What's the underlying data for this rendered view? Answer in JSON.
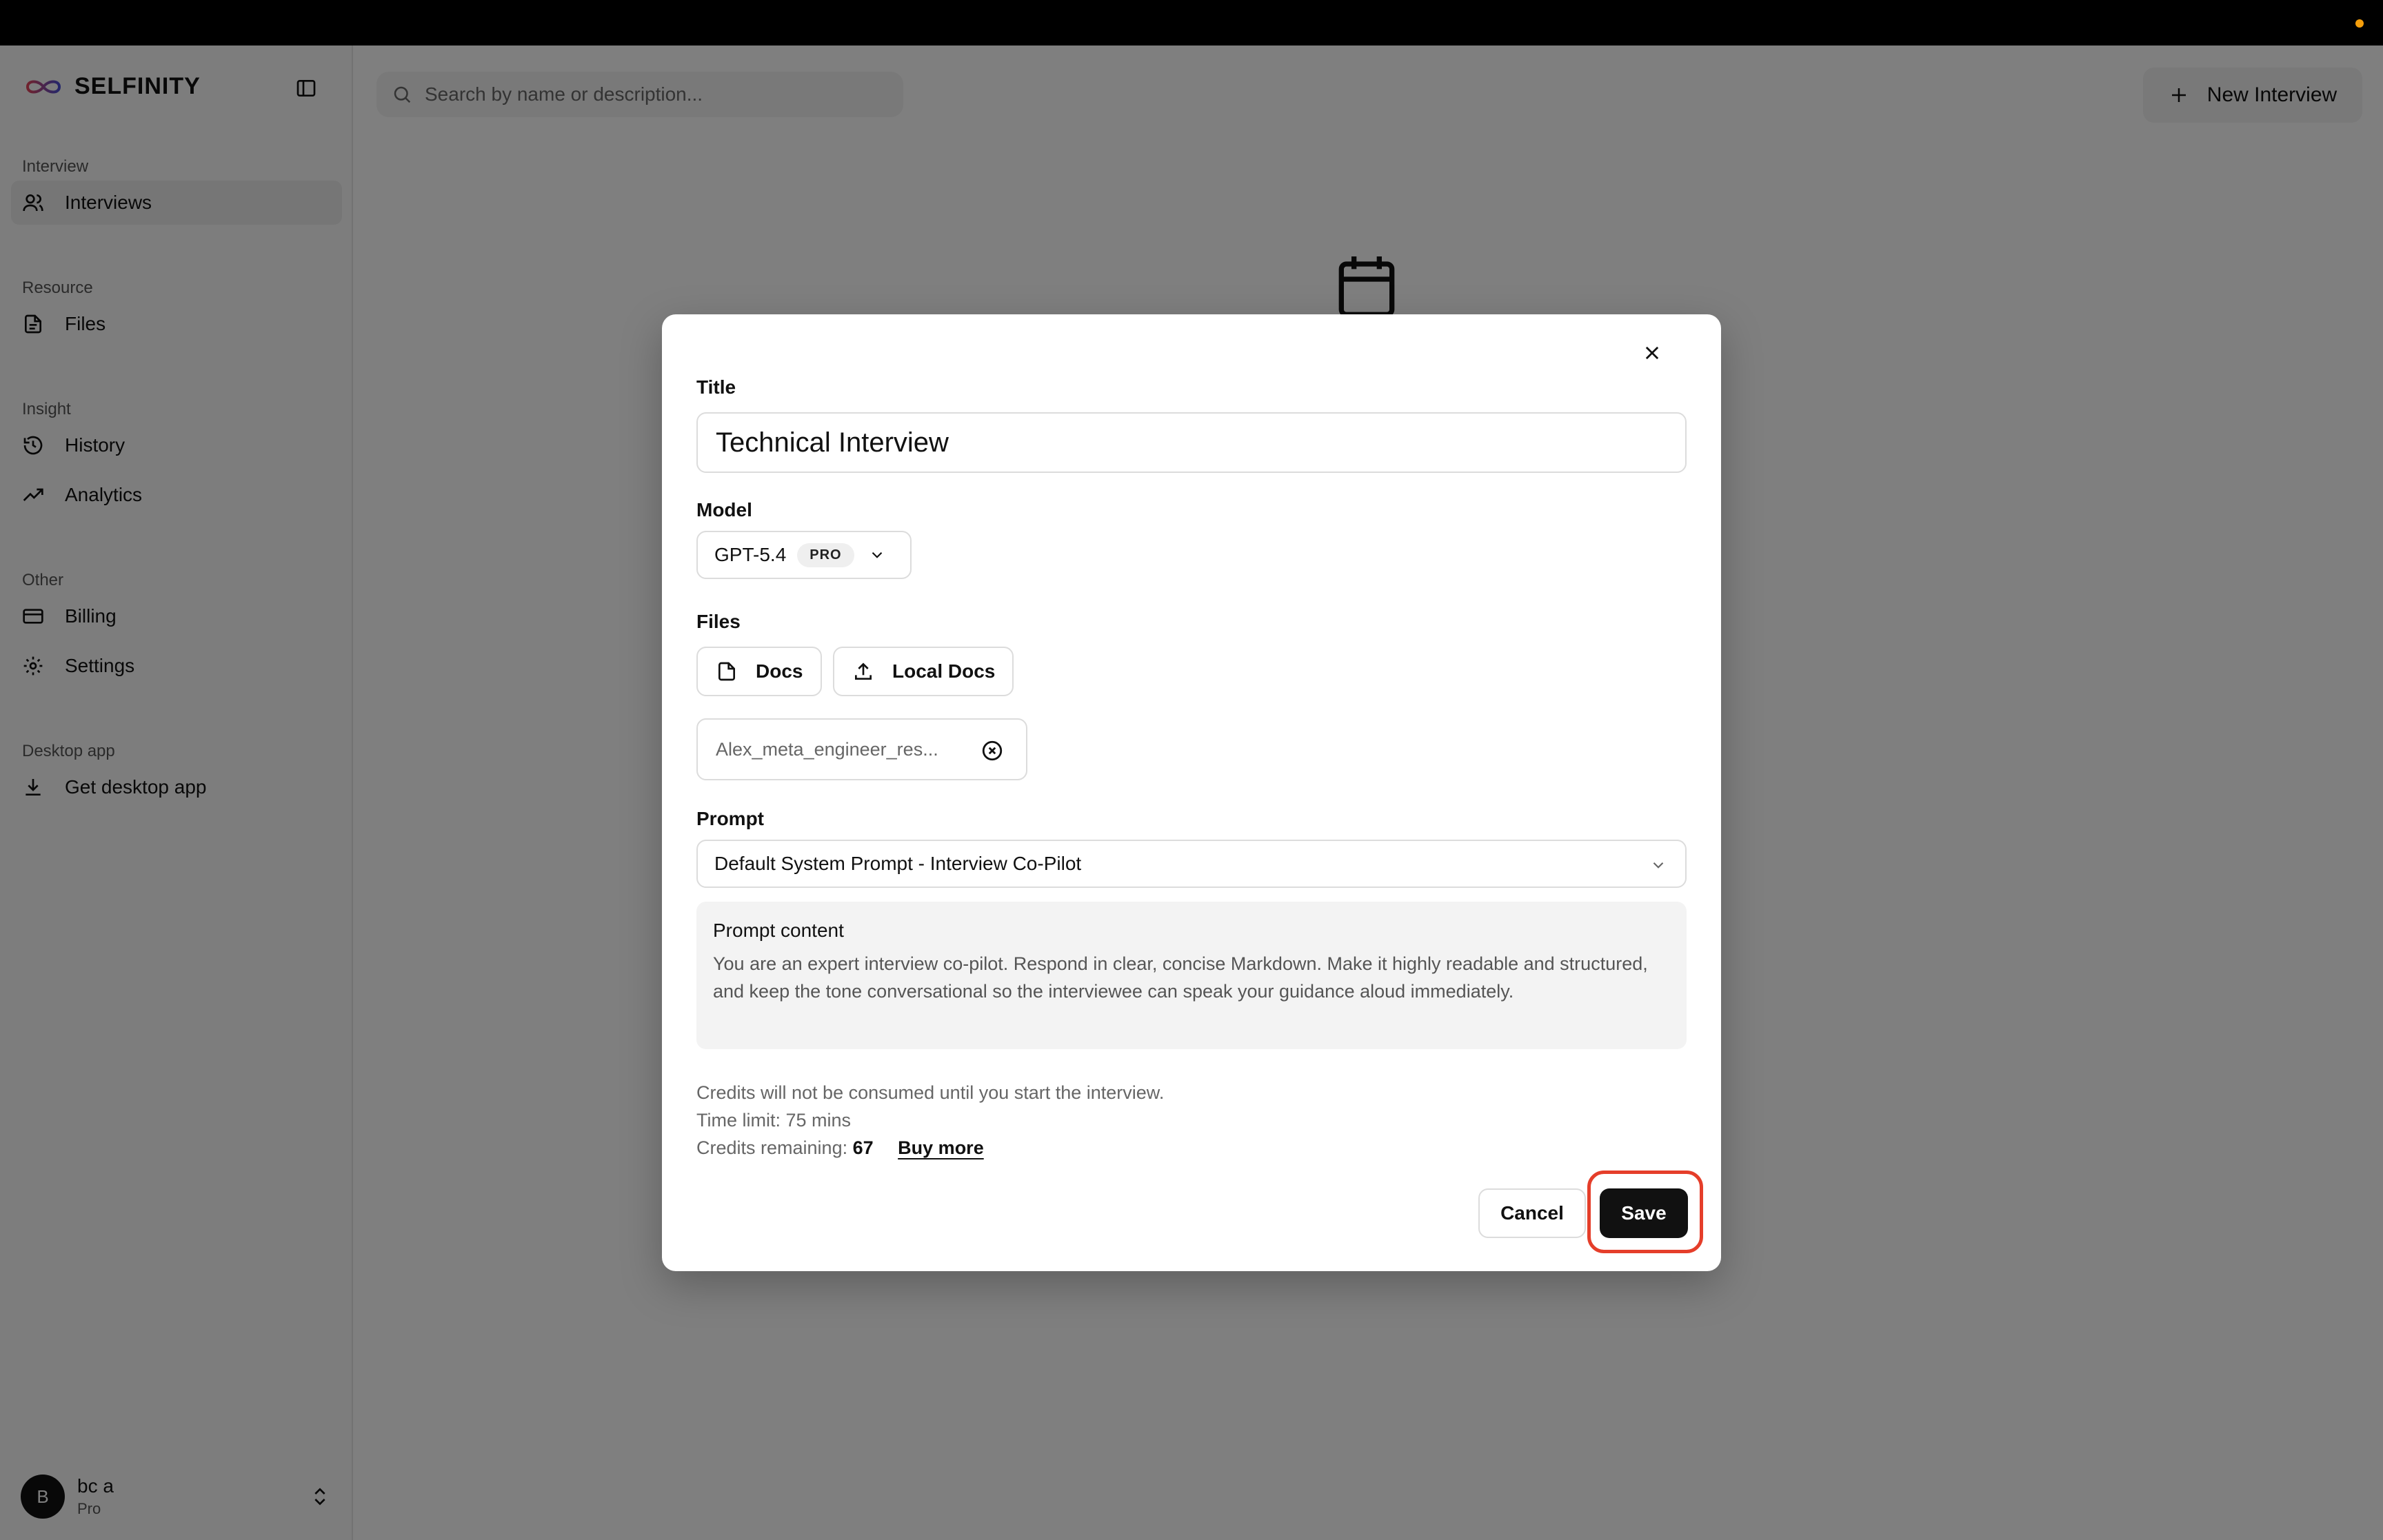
{
  "brand": {
    "name": "SELFINITY"
  },
  "sidebar": {
    "sections": [
      {
        "heading": "Interview",
        "items": [
          {
            "label": "Interviews",
            "icon": "users-icon",
            "active": true
          }
        ]
      },
      {
        "heading": "Resource",
        "items": [
          {
            "label": "Files",
            "icon": "file-icon"
          }
        ]
      },
      {
        "heading": "Insight",
        "items": [
          {
            "label": "History",
            "icon": "history-icon"
          },
          {
            "label": "Analytics",
            "icon": "trending-up-icon"
          }
        ]
      },
      {
        "heading": "Other",
        "items": [
          {
            "label": "Billing",
            "icon": "credit-card-icon"
          },
          {
            "label": "Settings",
            "icon": "gear-icon"
          }
        ]
      },
      {
        "heading": "Desktop app",
        "items": [
          {
            "label": "Get desktop app",
            "icon": "download-icon"
          }
        ]
      }
    ],
    "user": {
      "initial": "B",
      "name": "bc a",
      "plan": "Pro"
    }
  },
  "header": {
    "search_placeholder": "Search by name or description...",
    "new_button_label": "New Interview"
  },
  "modal": {
    "title_label": "Title",
    "title_value": "Technical Interview",
    "model_label": "Model",
    "model_value": "GPT-5.4",
    "model_badge": "PRO",
    "files_label": "Files",
    "docs_button": "Docs",
    "local_docs_button": "Local Docs",
    "attached_file": "Alex_meta_engineer_res...",
    "prompt_label": "Prompt",
    "prompt_value": "Default System Prompt - Interview Co-Pilot",
    "prompt_content_title": "Prompt content",
    "prompt_content_text": "You are an expert interview co-pilot. Respond in clear, concise Markdown. Make it highly readable and structured, and keep the tone conversational so the interviewee can speak your guidance aloud immediately.",
    "credits_note": "Credits will not be consumed until you start the interview.",
    "time_limit": "Time limit: 75 mins",
    "credits_remaining_label": "Credits remaining:",
    "credits_remaining_value": "67",
    "buy_more": "Buy more",
    "cancel_label": "Cancel",
    "save_label": "Save"
  },
  "colors": {
    "accent_dark": "#111111",
    "highlight_ring": "#e53e2a",
    "status_dot": "#f59e0b"
  }
}
